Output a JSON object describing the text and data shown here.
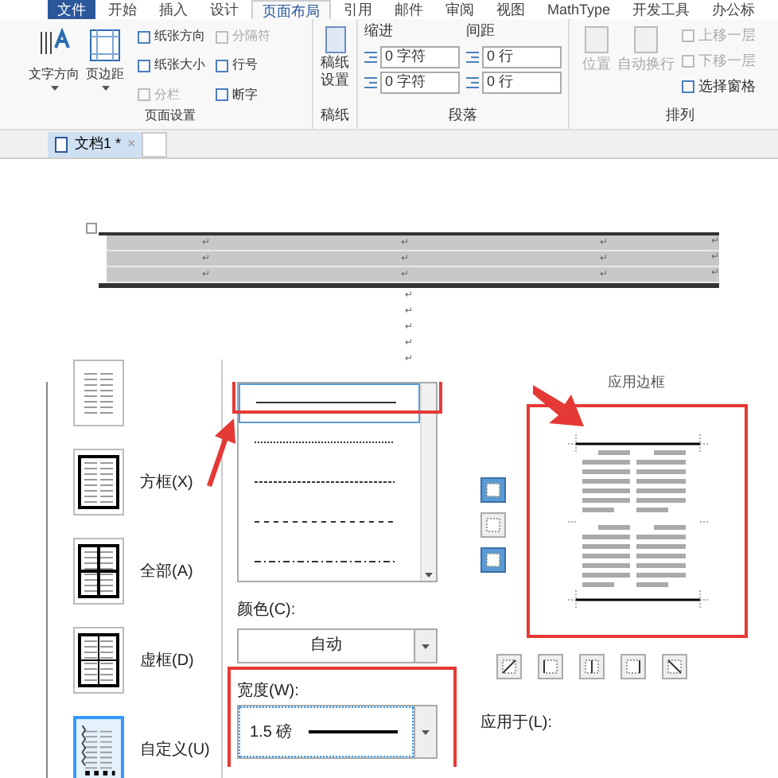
{
  "ribbon_tabs": [
    {
      "label": "文件",
      "kind": "file",
      "selected": false
    },
    {
      "label": "开始",
      "kind": "tab",
      "selected": false
    },
    {
      "label": "插入",
      "kind": "tab",
      "selected": false
    },
    {
      "label": "设计",
      "kind": "tab",
      "selected": false
    },
    {
      "label": "页面布局",
      "kind": "tab",
      "selected": true
    },
    {
      "label": "引用",
      "kind": "tab",
      "selected": false
    },
    {
      "label": "邮件",
      "kind": "tab",
      "selected": false
    },
    {
      "label": "审阅",
      "kind": "tab",
      "selected": false
    },
    {
      "label": "视图",
      "kind": "tab",
      "selected": false
    },
    {
      "label": "MathType",
      "kind": "tab",
      "selected": false
    },
    {
      "label": "开发工具",
      "kind": "tab",
      "selected": false
    },
    {
      "label": "办公标",
      "kind": "tab",
      "selected": false
    }
  ],
  "page_setup": {
    "title": "页面设置",
    "large_buttons": [
      "文字方向",
      "页边距"
    ],
    "small_buttons": [
      {
        "label": "纸张方向",
        "disabled": false
      },
      {
        "label": "分隔符",
        "disabled": true
      },
      {
        "label": "纸张大小",
        "disabled": false
      },
      {
        "label": "行号",
        "disabled": false
      },
      {
        "label": "分栏",
        "disabled": true
      },
      {
        "label": "断字",
        "disabled": false
      }
    ]
  },
  "manuscript": {
    "title": "稿纸",
    "button": "稿纸设置"
  },
  "paragraph": {
    "title": "段落",
    "indent_label": "缩进",
    "spacing_label": "间距",
    "indent_fields": [
      "0 字符",
      "0 字符"
    ],
    "spacing_fields": [
      "0 行",
      "0 行"
    ]
  },
  "arrange": {
    "title": "排列",
    "large_buttons": [
      {
        "label": "位置",
        "disabled": true
      },
      {
        "label": "自动换行",
        "disabled": true
      }
    ],
    "small_buttons": [
      {
        "label": "上移一层",
        "disabled": true
      },
      {
        "label": "下移一层",
        "disabled": true
      },
      {
        "label": "选择窗格",
        "disabled": false
      }
    ]
  },
  "document_tabs": [
    {
      "label": "文档1 *",
      "close": "×",
      "selected": true
    }
  ],
  "document": {
    "table_rows": [
      [
        "↵",
        "↵",
        "↵",
        "↵"
      ],
      [
        "↵",
        "↵",
        "↵",
        "↵"
      ],
      [
        "↵",
        "↵",
        "↵",
        "↵"
      ]
    ],
    "paragraph_marks": [
      "↵",
      "↵",
      "↵",
      "↵",
      "↵"
    ]
  },
  "dialog": {
    "settings": [
      {
        "kind": "none",
        "selected": false
      },
      {
        "label": "方框(X)",
        "kind": "box",
        "selected": false
      },
      {
        "label": "全部(A)",
        "kind": "all",
        "selected": false
      },
      {
        "label": "虚框(D)",
        "kind": "grid",
        "selected": false
      },
      {
        "label": "自定义(U)",
        "kind": "custom",
        "selected": true
      }
    ],
    "line_styles": [
      {
        "kind": "solid",
        "selected": true
      },
      {
        "kind": "dotted",
        "selected": false
      },
      {
        "kind": "fine-dash",
        "selected": false
      },
      {
        "kind": "dash",
        "selected": false
      },
      {
        "kind": "dash-dot",
        "selected": false
      }
    ],
    "color_label": "颜色(C):",
    "color_value": "自动",
    "width_label": "宽度(W):",
    "width_value": "1.5 磅",
    "preview_heading": "应用边框",
    "side_buttons": [
      {
        "selected": true
      },
      {
        "selected": false
      },
      {
        "selected": true
      }
    ],
    "bottom_buttons": [
      {
        "kind": "diag-up",
        "selected": false
      },
      {
        "kind": "left",
        "selected": false
      },
      {
        "kind": "center",
        "selected": false
      },
      {
        "kind": "right",
        "selected": false
      },
      {
        "kind": "diag-down",
        "selected": false
      }
    ],
    "apply_label": "应用于(L):"
  }
}
